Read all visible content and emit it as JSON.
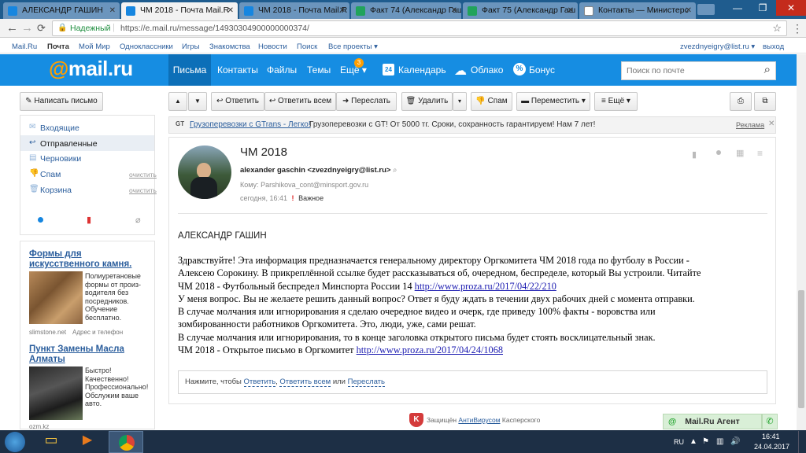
{
  "browser": {
    "tabs": [
      {
        "label": "АЛЕКСАНДР ГАШИН",
        "favicon_color": "#1686e0"
      },
      {
        "label": "ЧМ 2018 - Почта Mail.R",
        "favicon_color": "#1686e0"
      },
      {
        "label": "ЧМ 2018 - Почта Mail.R",
        "favicon_color": "#1686e0"
      },
      {
        "label": "Факт 74 (Александр Гаш",
        "favicon_color": "#21a35b"
      },
      {
        "label": "Факт 75 (Александр Гаш",
        "favicon_color": "#21a35b"
      },
      {
        "label": "Контакты — Министерс",
        "favicon_color": "#ffffff"
      }
    ],
    "secure_label": "Надежный",
    "url": "https://e.mail.ru/message/14930304900000000374/"
  },
  "portal": {
    "links": [
      "Mail.Ru",
      "Почта",
      "Мой Мир",
      "Одноклассники",
      "Игры",
      "Знакомства",
      "Новости",
      "Поиск",
      "Все проекты"
    ],
    "user_email": "zvezdnyeigry@list.ru",
    "logout": "выход"
  },
  "header": {
    "logo": "@mail.ru",
    "nav": [
      "Письма",
      "Контакты",
      "Файлы",
      "Темы",
      "Ещё"
    ],
    "nav_badge": "3",
    "services": [
      "Календарь",
      "Облако",
      "Бонус"
    ],
    "calendar_day": "24",
    "search_placeholder": "Поиск по почте",
    "accent_color": "#168de2"
  },
  "toolbar": {
    "compose": "Написать письмо",
    "reply": "Ответить",
    "reply_all": "Ответить всем",
    "forward": "Переслать",
    "delete": "Удалить",
    "spam": "Спам",
    "move": "Переместить",
    "more": "Ещё"
  },
  "folders": [
    {
      "label": "Входящие",
      "clean": ""
    },
    {
      "label": "Отправленные",
      "clean": ""
    },
    {
      "label": "Черновики",
      "clean": ""
    },
    {
      "label": "Спам",
      "clean": "очистить"
    },
    {
      "label": "Корзина",
      "clean": "очистить"
    }
  ],
  "ads": [
    {
      "title": "Формы для искусственного камня.",
      "text": "Полиуретановые формы от произ-водителя без посредников. Обучение бесплатно.",
      "source": "slimstone.net",
      "extra": "Адрес и телефон"
    },
    {
      "title": "Пункт Замены Масла Алматы",
      "text": "Быстро! Качественно! Профессионально! Обслужим ваше авто.",
      "source": "ozm.kz",
      "extra": ""
    }
  ],
  "ad_banner": {
    "link": "Грузоперевозки с GTrans - Легко!",
    "text": "Грузоперевозки с GT! От 5000 тг. Сроки, сохранность гарантируем! Нам 7 лет!",
    "label": "Реклама"
  },
  "message": {
    "subject": "ЧМ 2018",
    "from": "alexander gaschin <zvezdnyeigry@list.ru>",
    "to_label": "Кому:",
    "to": "Parshikova_cont@minsport.gov.ru",
    "date": "сегодня, 16:41",
    "importance": "Важное",
    "greeting": "АЛЕКСАНДР ГАШИН",
    "lines": [
      "Здравствуйте! Эта информация предназначается генеральному директору Оргкомитета ЧМ 2018 года по футболу в России -",
      "Алексею Сорокину. В прикреплённой ссылке будет рассказываться об, очередном, беспределе, который Вы устроили. Читайте",
      "ЧМ 2018 - Футбольный беспредел Минспорта России 14",
      "У меня вопрос. Вы не желаете решить данный вопрос? Ответ я буду ждать в течении двух рабочих дней с момента отправки.",
      "В случае молчания или игнорирования я сделаю очередное видео и очерк, где приведу 100% факты - воровства или",
      "зомбированности работников Оргкомитета. Это, люди, уже, сами решат.",
      "В случае молчания или игнорирования, то в конце заголовка открытого письма будет стоять восклицательный знак.",
      "ЧМ 2018 - Открытое письмо в Оргкомитет"
    ],
    "link1": "http://www.proza.ru/2017/04/22/210",
    "link2": "http://www.proza.ru/2017/04/24/1068"
  },
  "quick_reply": {
    "prefix": "Нажмите, чтобы",
    "reply": "Ответить",
    "reply_all": "Ответить всем",
    "or": "или",
    "forward": "Переслать"
  },
  "footer": {
    "protected": "Защищён",
    "antivirus": "АнтиВирусом",
    "kaspersky": "Касперского",
    "agent": "Mail.Ru Агент"
  },
  "taskbar": {
    "lang": "RU",
    "time": "16:41",
    "date": "24.04.2017"
  }
}
